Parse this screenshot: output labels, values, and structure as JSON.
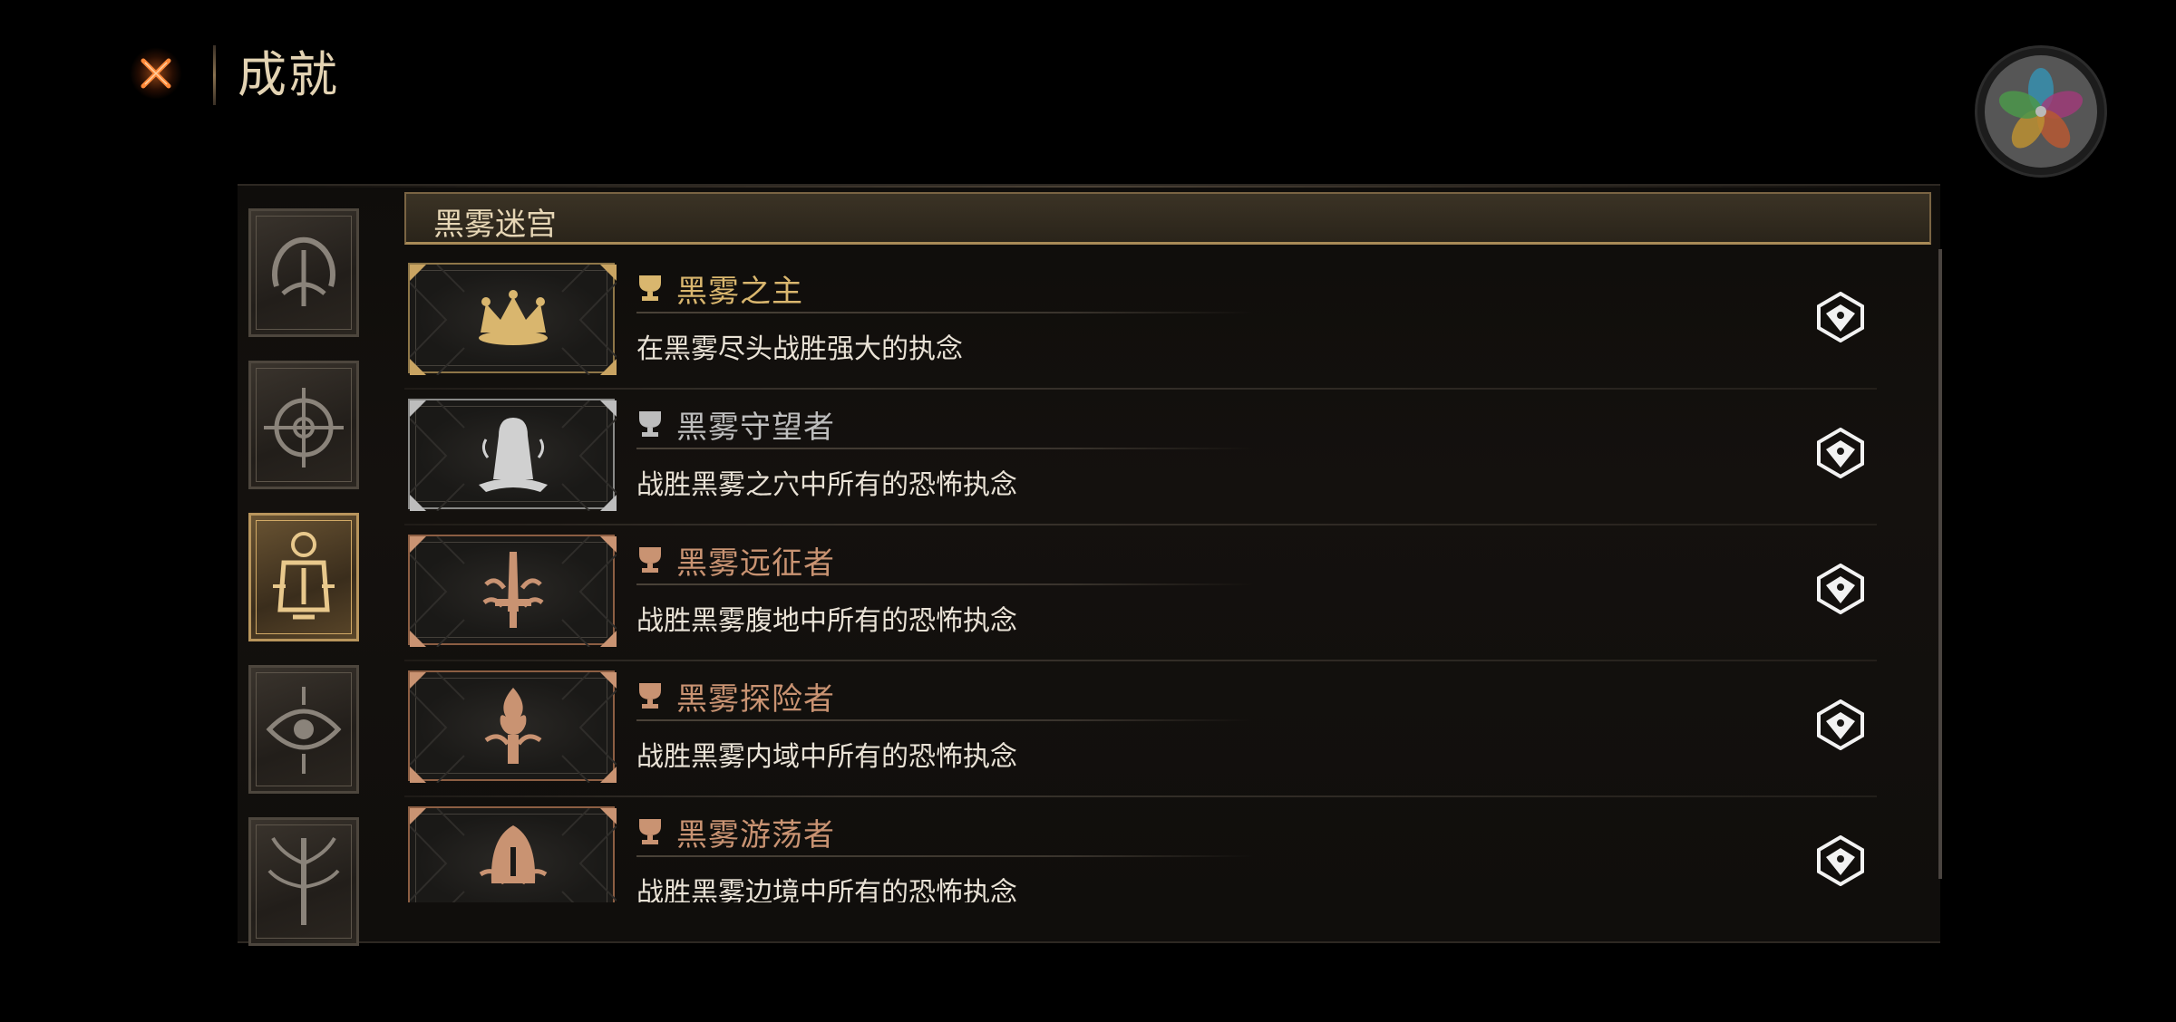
{
  "header": {
    "title": "成就"
  },
  "section": {
    "title": "黑雾迷宫"
  },
  "categories": [
    {
      "icon": "arch-sigil-icon",
      "active": false
    },
    {
      "icon": "compass-sigil-icon",
      "active": false
    },
    {
      "icon": "lantern-sigil-icon",
      "active": true
    },
    {
      "icon": "eye-sigil-icon",
      "active": false
    },
    {
      "icon": "tree-sigil-icon",
      "active": false
    }
  ],
  "achievements": [
    {
      "title": "黑雾之主",
      "description": "在黑雾尽头战胜强大的执念",
      "tier": "gold",
      "badge_icon": "crown-icon"
    },
    {
      "title": "黑雾守望者",
      "description": "战胜黑雾之穴中所有的恐怖执念",
      "tier": "silver",
      "badge_icon": "hooded-figure-icon"
    },
    {
      "title": "黑雾远征者",
      "description": "战胜黑雾腹地中所有的恐怖执念",
      "tier": "bronze",
      "badge_icon": "sword-icon"
    },
    {
      "title": "黑雾探险者",
      "description": "战胜黑雾内域中所有的恐怖执念",
      "tier": "bronze",
      "badge_icon": "torch-icon"
    },
    {
      "title": "黑雾游荡者",
      "description": "战胜黑雾边境中所有的恐怖执念",
      "tier": "bronze",
      "badge_icon": "hood-icon"
    }
  ],
  "colors": {
    "gold": "#d9b66e",
    "silver": "#bdbdbd",
    "bronze": "#c99372",
    "accent_orange": "#ff7a30"
  }
}
